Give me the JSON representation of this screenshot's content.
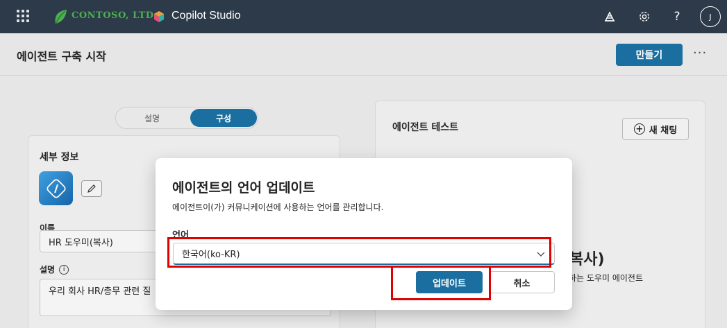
{
  "topbar": {
    "brand": "CONTOSO, LTD.",
    "app_name": "Copilot Studio",
    "avatar_initial": "J",
    "help_glyph": "?",
    "icons": [
      "waffle-icon",
      "contoso-leaf-icon",
      "copilot-studio-icon",
      "environment-icon",
      "settings-icon",
      "help-icon"
    ]
  },
  "header": {
    "title": "에이전트 구축 시작",
    "create_label": "만들기",
    "more_label": "···"
  },
  "tabs": [
    "설명",
    "구성"
  ],
  "details": {
    "title": "세부 정보",
    "name_label": "이름",
    "name_value": "HR 도우미(복사)",
    "desc_label": "설명",
    "desc_value": "우리 회사 HR/총무 관련 질"
  },
  "test_panel": {
    "title": "에이전트 테스트",
    "new_chat_label": "새 채팅",
    "heading_tail": "복사)",
    "sub_tail": "하는 도우미 에이전트"
  },
  "dialog": {
    "title": "에이전트의 언어 업데이트",
    "description": "에이전트이(가) 커뮤니케이션에 사용하는 언어를 관리합니다.",
    "language_label": "언어",
    "language_value": "한국어(ko-KR)",
    "update_label": "업데이트",
    "cancel_label": "취소"
  },
  "colors": {
    "topbar": "#2d3a49",
    "primary": "#1a6fa0",
    "highlight": "#e00000"
  }
}
